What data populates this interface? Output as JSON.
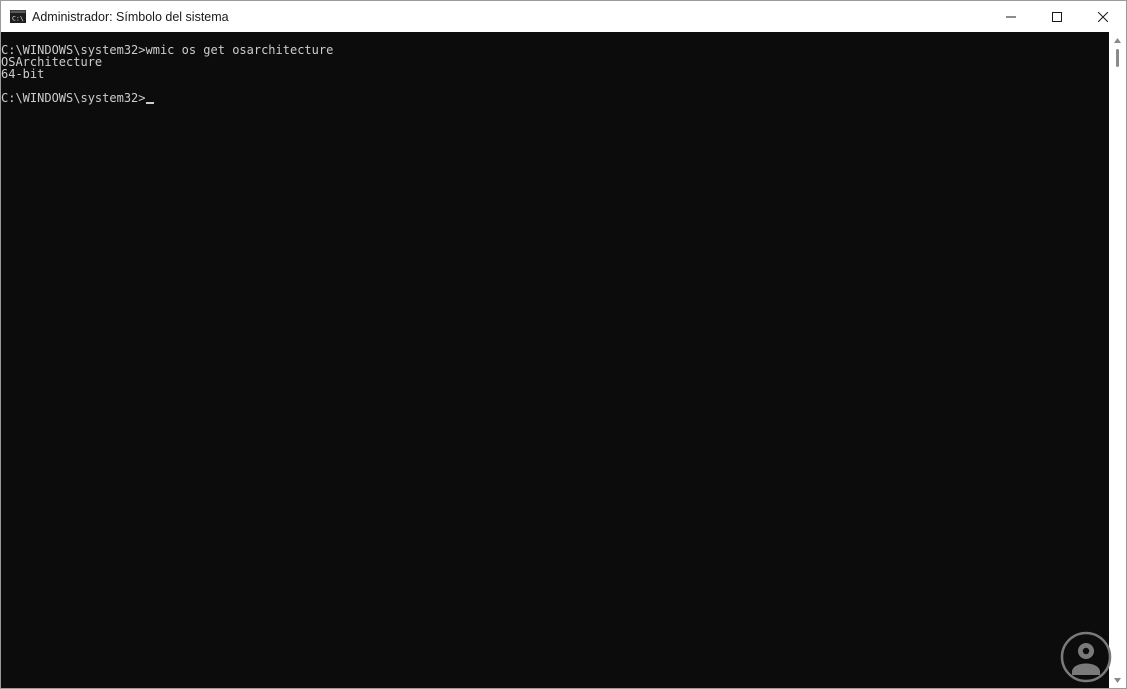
{
  "window": {
    "title": "Administrador: Símbolo del sistema",
    "icon": "cmd-icon",
    "controls": [
      "minimize-icon",
      "maximize-icon",
      "close-icon"
    ]
  },
  "console": {
    "lines": [
      "C:\\WINDOWS\\system32>wmic os get osarchitecture",
      "OSArchitecture",
      "64-bit",
      "",
      "C:\\WINDOWS\\system32>"
    ]
  },
  "colors": {
    "console_bg": "#0c0c0c",
    "console_fg": "#cccccc",
    "titlebar_bg": "#ffffff"
  }
}
